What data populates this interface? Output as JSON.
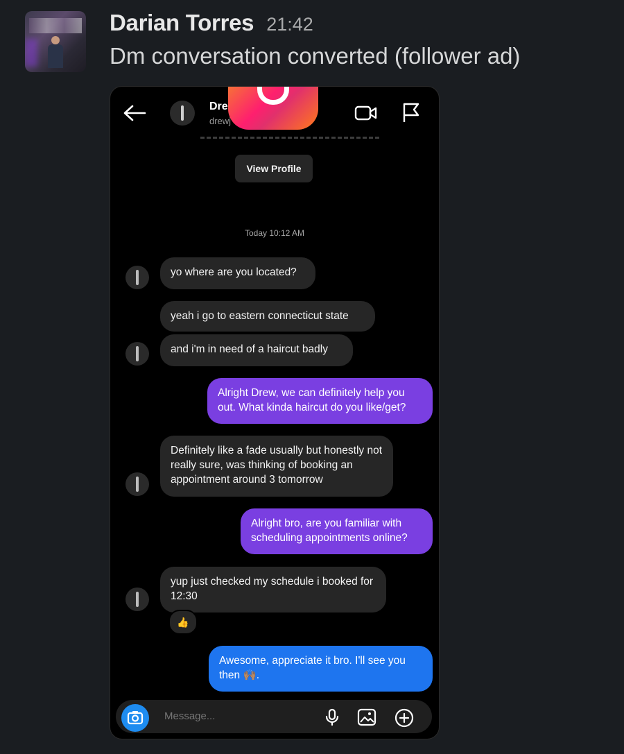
{
  "message": {
    "author": "Darian Torres",
    "time": "21:42",
    "text": "Dm conversation converted (follower ad)"
  },
  "screenshot": {
    "contact_name": "Dre",
    "contact_handle": "drewj",
    "view_profile_label": "View Profile",
    "date_divider": "Today 10:12 AM",
    "composer_placeholder": "Message...",
    "reaction": "👍",
    "messages": [
      {
        "from": "them",
        "text": "yo where are you located?"
      },
      {
        "from": "them",
        "text": "yeah i go to eastern connecticut state"
      },
      {
        "from": "them",
        "text": "and i'm in need of a haircut badly"
      },
      {
        "from": "me",
        "text": "Alright Drew, we can definitely help you out. What kinda haircut do you like/get?"
      },
      {
        "from": "them",
        "text": "Definitely like a fade usually but honestly not really sure, was thinking of booking an appointment around 3 tomorrow"
      },
      {
        "from": "me",
        "text": "Alright bro, are you familiar with scheduling appointments online?"
      },
      {
        "from": "them",
        "text": "yup just checked my schedule i booked for 12:30"
      },
      {
        "from": "me",
        "text": "Awesome, appreciate it bro. I'll see you then 🙌🏽."
      }
    ]
  },
  "colors": {
    "background": "#1a1d21",
    "outgoing_purple": "#7a3fe1",
    "outgoing_blue": "#1e75ef",
    "incoming": "#262626"
  }
}
